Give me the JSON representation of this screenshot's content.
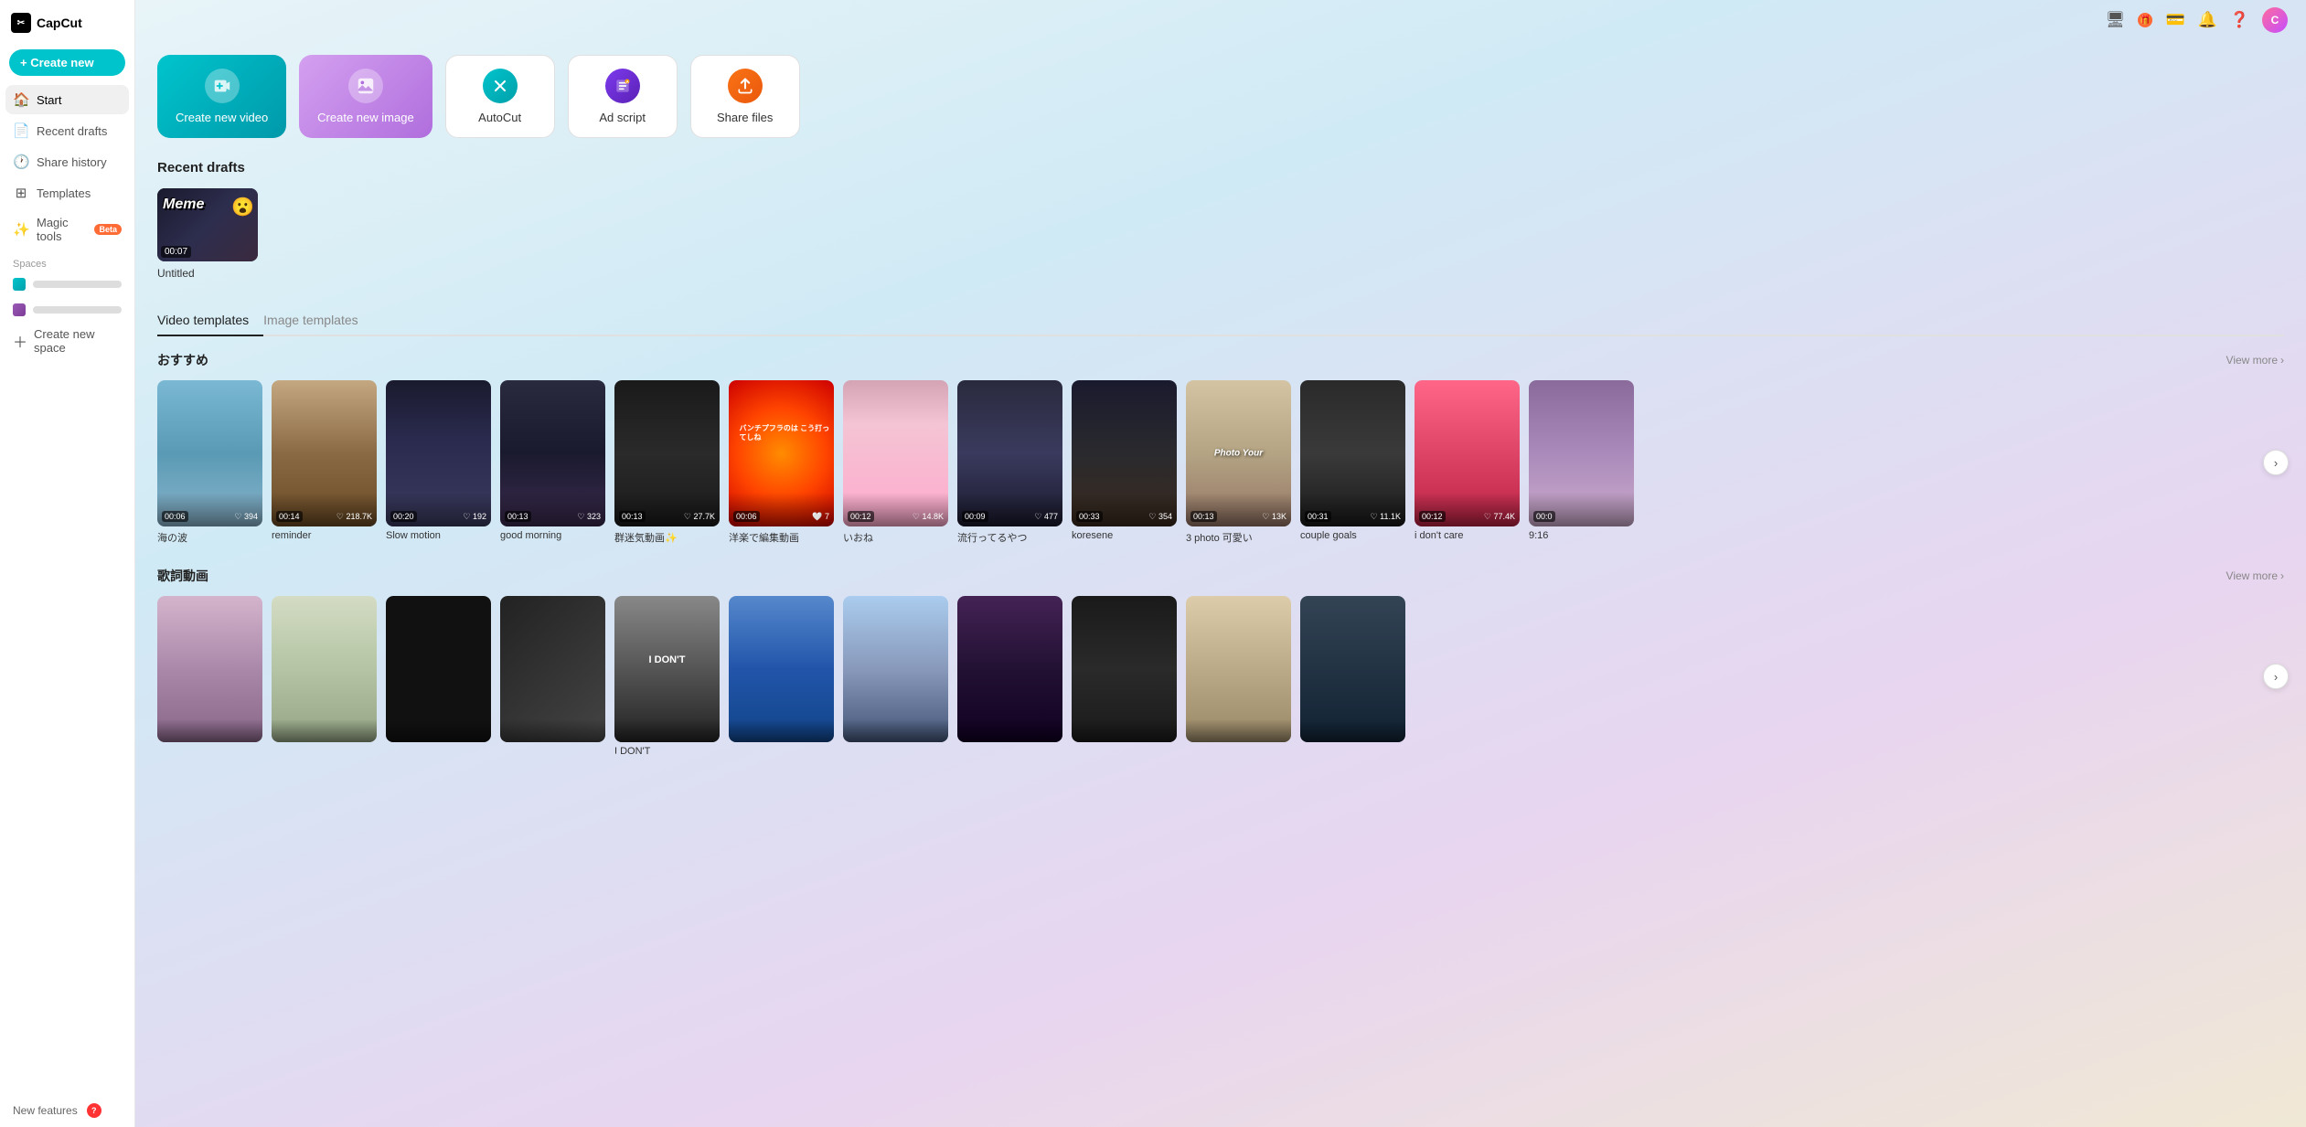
{
  "app": {
    "name": "CapCut",
    "logo_text": "CapCut"
  },
  "topbar": {
    "icons": [
      "monitor-icon",
      "gift-icon",
      "wallet-icon",
      "bell-icon",
      "help-icon"
    ],
    "avatar_initial": "C",
    "gift_badge": ""
  },
  "sidebar": {
    "create_new_label": "+ Create new",
    "nav_items": [
      {
        "id": "start",
        "label": "Start",
        "icon": "🏠",
        "active": true
      },
      {
        "id": "recent-drafts",
        "label": "Recent drafts",
        "icon": "📄"
      },
      {
        "id": "share-history",
        "label": "Share history",
        "icon": "🕐"
      },
      {
        "id": "templates",
        "label": "Templates",
        "icon": "⊞"
      },
      {
        "id": "magic-tools",
        "label": "Magic tools",
        "icon": "✨",
        "badge": "Beta"
      }
    ],
    "spaces_label": "Spaces",
    "spaces": [
      {
        "id": "space1",
        "color": "#00c4cc",
        "color2": "#00a0aa"
      },
      {
        "id": "space2",
        "color": "#9b59b6",
        "color2": "#7d3c98"
      }
    ],
    "create_new_space_label": "Create new space",
    "new_features_label": "New features"
  },
  "quick_actions": [
    {
      "id": "create-video",
      "label": "Create new video",
      "icon": "🎬",
      "style": "video"
    },
    {
      "id": "create-image",
      "label": "Create new image",
      "icon": "🖼",
      "style": "image"
    },
    {
      "id": "autocut",
      "label": "AutoCut",
      "icon": "✂",
      "style": "white"
    },
    {
      "id": "ad-script",
      "label": "Ad script",
      "icon": "📋",
      "style": "white"
    },
    {
      "id": "share-files",
      "label": "Share files",
      "icon": "📤",
      "style": "white"
    }
  ],
  "recent_drafts": {
    "title": "Recent drafts",
    "items": [
      {
        "id": "draft1",
        "name": "Untitled",
        "duration": "00:07",
        "thumb_text": "Meme"
      }
    ]
  },
  "video_templates": {
    "active_tab": "Video templates",
    "inactive_tab": "Image templates",
    "sections": [
      {
        "id": "osusume",
        "label": "おすすめ",
        "view_more": "View more",
        "items": [
          {
            "id": "t1",
            "name": "海の波",
            "duration": "00:06",
            "likes": "394",
            "like_icon": "♡",
            "style": "t1"
          },
          {
            "id": "t2",
            "name": "reminder",
            "duration": "00:14",
            "likes": "218.7K",
            "like_icon": "♡",
            "style": "t2"
          },
          {
            "id": "t3",
            "name": "Slow motion",
            "duration": "00:20",
            "likes": "192",
            "like_icon": "♡",
            "style": "t3"
          },
          {
            "id": "t4",
            "name": "good morning",
            "duration": "00:13",
            "likes": "323",
            "like_icon": "♡",
            "style": "t4"
          },
          {
            "id": "t5",
            "name": "群迷気動画✨",
            "duration": "00:13",
            "likes": "27.7K",
            "like_icon": "♡",
            "style": "t5"
          },
          {
            "id": "t6",
            "name": "洋楽で編集動画",
            "duration": "00:06",
            "likes": "7",
            "like_icon": "🤍",
            "style": "t6"
          },
          {
            "id": "t7",
            "name": "いおね",
            "duration": "00:12",
            "likes": "14.8K",
            "like_icon": "♡",
            "style": "t7"
          },
          {
            "id": "t8",
            "name": "流行ってるやつ",
            "duration": "00:09",
            "likes": "477",
            "like_icon": "♡",
            "style": "t8"
          },
          {
            "id": "t9",
            "name": "koresene",
            "duration": "00:33",
            "likes": "354",
            "like_icon": "♡",
            "style": "t9"
          },
          {
            "id": "t10",
            "name": "3 photo 可愛い",
            "duration": "00:13",
            "likes": "13K",
            "like_icon": "♡",
            "style": "t10"
          },
          {
            "id": "t11",
            "name": "couple goals",
            "duration": "00:31",
            "likes": "11.1K",
            "like_icon": "♡",
            "style": "t11"
          },
          {
            "id": "t12",
            "name": "i don't care",
            "duration": "00:12",
            "likes": "77.4K",
            "like_icon": "♡",
            "style": "t12"
          },
          {
            "id": "t13",
            "name": "9:16",
            "duration": "00:0",
            "likes": "",
            "like_icon": "",
            "style": "t13"
          }
        ]
      },
      {
        "id": "lyric-video",
        "label": "歌詞動画",
        "view_more": "View more",
        "items": [
          {
            "id": "s1",
            "name": "",
            "duration": "",
            "likes": "",
            "like_icon": "",
            "style": "s1"
          },
          {
            "id": "s2",
            "name": "",
            "duration": "",
            "likes": "",
            "like_icon": "",
            "style": "s2"
          },
          {
            "id": "s3",
            "name": "",
            "duration": "",
            "likes": "",
            "like_icon": "",
            "style": "s3"
          },
          {
            "id": "s4",
            "name": "",
            "duration": "",
            "likes": "",
            "like_icon": "",
            "style": "s4"
          },
          {
            "id": "s5",
            "name": "I DON'T",
            "duration": "",
            "likes": "",
            "like_icon": "",
            "style": "s5"
          },
          {
            "id": "s6",
            "name": "",
            "duration": "",
            "likes": "",
            "like_icon": "",
            "style": "s6"
          },
          {
            "id": "s7",
            "name": "",
            "duration": "",
            "likes": "",
            "like_icon": "",
            "style": "s7"
          },
          {
            "id": "s8",
            "name": "",
            "duration": "",
            "likes": "",
            "like_icon": "",
            "style": "s8"
          },
          {
            "id": "s9",
            "name": "",
            "duration": "",
            "likes": "",
            "like_icon": "",
            "style": "s9"
          },
          {
            "id": "s10",
            "name": "",
            "duration": "",
            "likes": "",
            "like_icon": "",
            "style": "s10"
          },
          {
            "id": "s11",
            "name": "",
            "duration": "",
            "likes": "",
            "like_icon": "",
            "style": "s11"
          }
        ]
      }
    ]
  }
}
